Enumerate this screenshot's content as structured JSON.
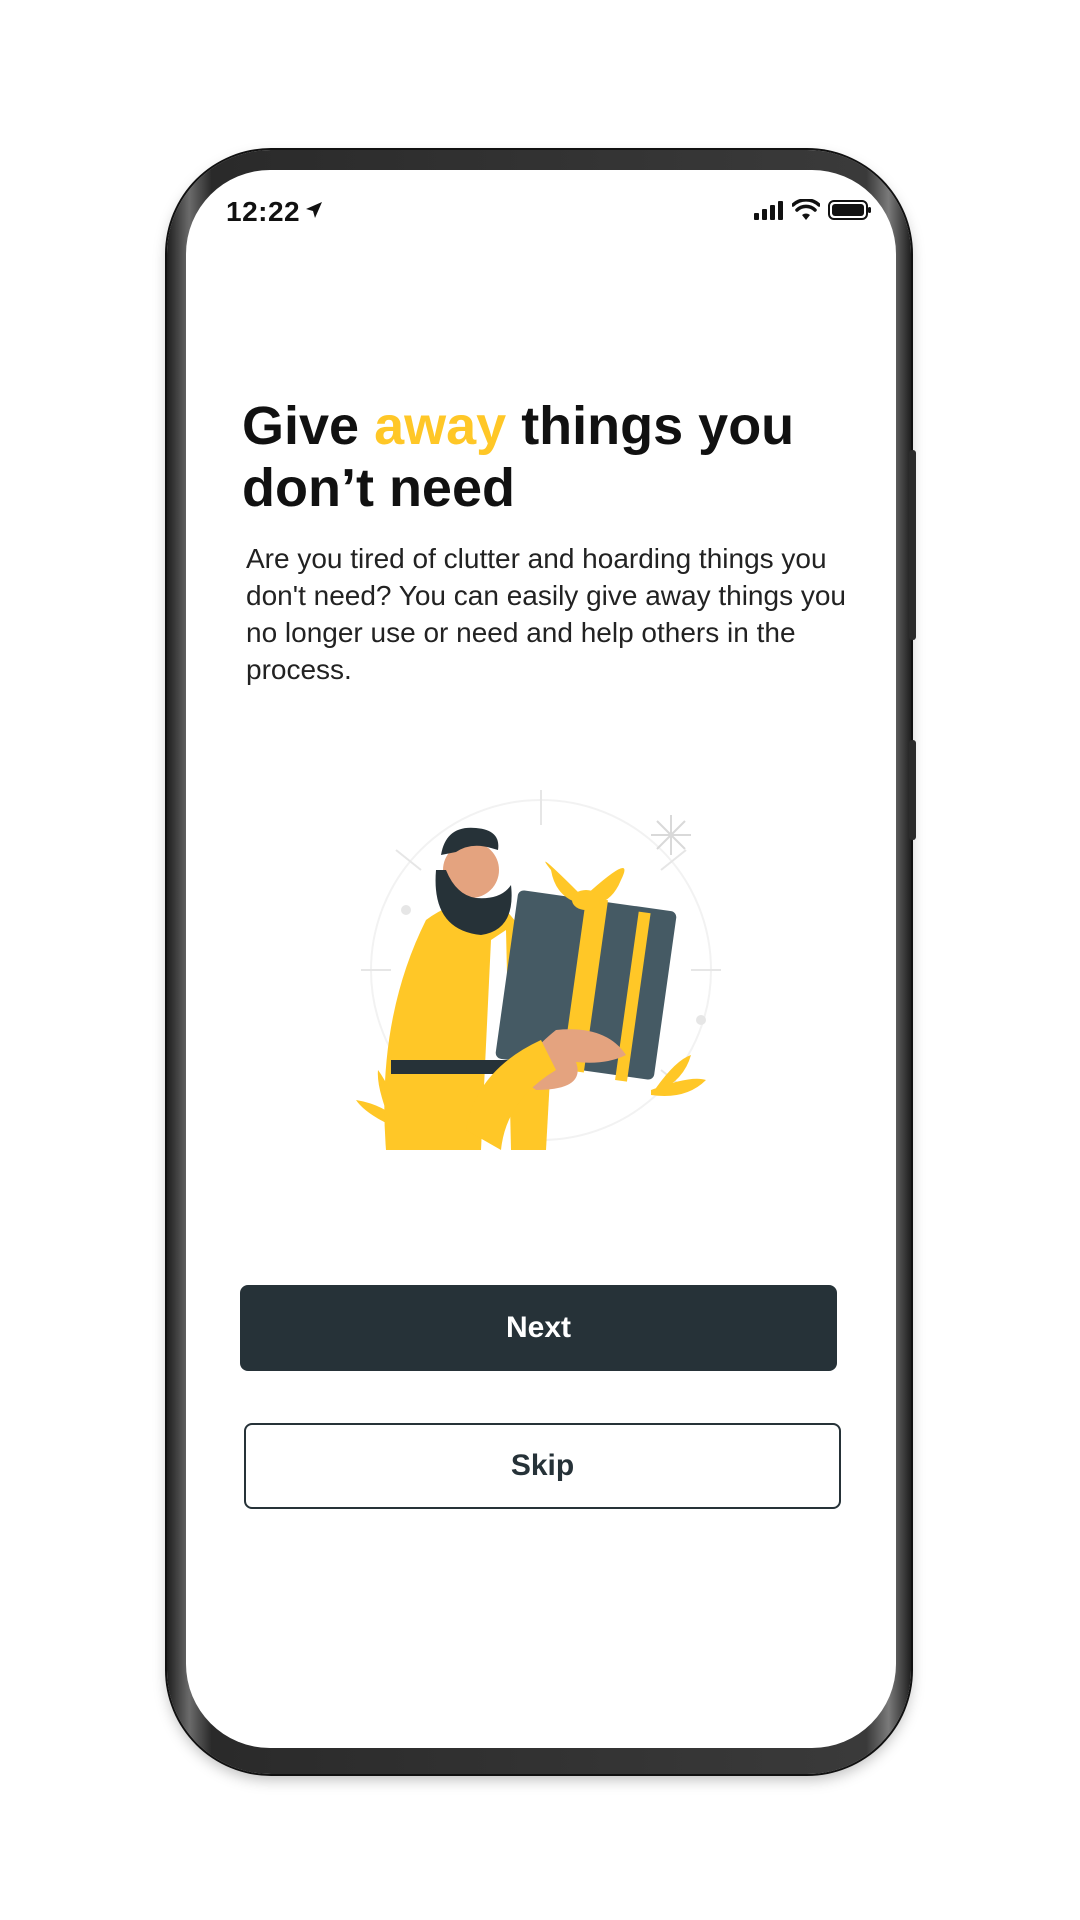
{
  "status_bar": {
    "time": "12:22",
    "icons": [
      "location-arrow-icon",
      "cellular-signal-icon",
      "wifi-icon",
      "battery-icon"
    ]
  },
  "onboarding": {
    "headline_part1": "Give ",
    "headline_accent": "away",
    "headline_part2": " things you don’t need",
    "description": "Are you tired of clutter and hoarding things you don't need? You can easily give away things you no longer use or need and help others in the process.",
    "illustration": "person-holding-gift-illustration"
  },
  "buttons": {
    "next_label": "Next",
    "skip_label": "Skip"
  },
  "colors": {
    "accent": "#FFC727",
    "primary_dark": "#263238",
    "text": "#111111",
    "background": "#FFFFFF"
  }
}
